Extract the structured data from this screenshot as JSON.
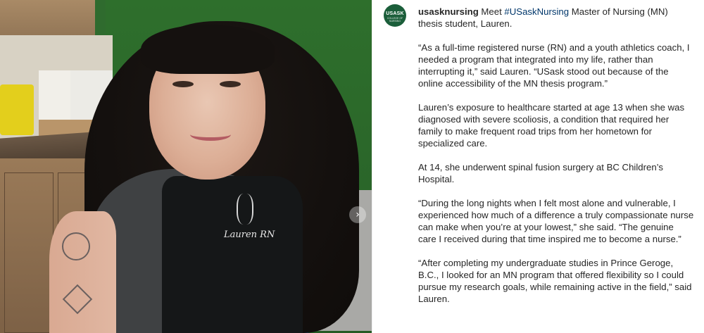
{
  "post": {
    "slide_arrow": "›",
    "account": {
      "avatar_line1": "USASK",
      "avatar_line2": "COLLEGE OF NURSING",
      "username": "usasknursing"
    },
    "photo": {
      "vest_text": "Lauren RN"
    },
    "caption": {
      "intro_before": "Meet",
      "hashtag": "#USaskNursing",
      "intro_after": "Master of Nursing (MN) thesis student, Lauren.",
      "paragraphs": [
        "“As a full-time registered nurse (RN) and a youth athletics coach, I needed a program that integrated into my life, rather than interrupting it,” said Lauren. “USask stood out because of the online accessibility of the MN thesis program.”",
        "Lauren’s exposure to healthcare started at age 13 when she was diagnosed with severe scoliosis, a condition that required her family to make frequent road trips from her hometown for specialized care.",
        "At 14, she underwent spinal fusion surgery at BC Children’s Hospital.",
        "“During the long nights when I felt most alone and vulnerable, I experienced how much of a difference a truly compassionate nurse can make when you’re at your lowest,” she said. “The genuine care I received during that time inspired me to become a nurse.”",
        "“After completing my undergraduate studies in Prince Geroge, B.C., I looked for an MN program that offered flexibility so I could pursue my research goals, while remaining active in the field,” said Lauren."
      ]
    }
  },
  "colors": {
    "hashtag": "#00376b",
    "avatar_bg": "#1b5e3a",
    "text": "#262626"
  }
}
